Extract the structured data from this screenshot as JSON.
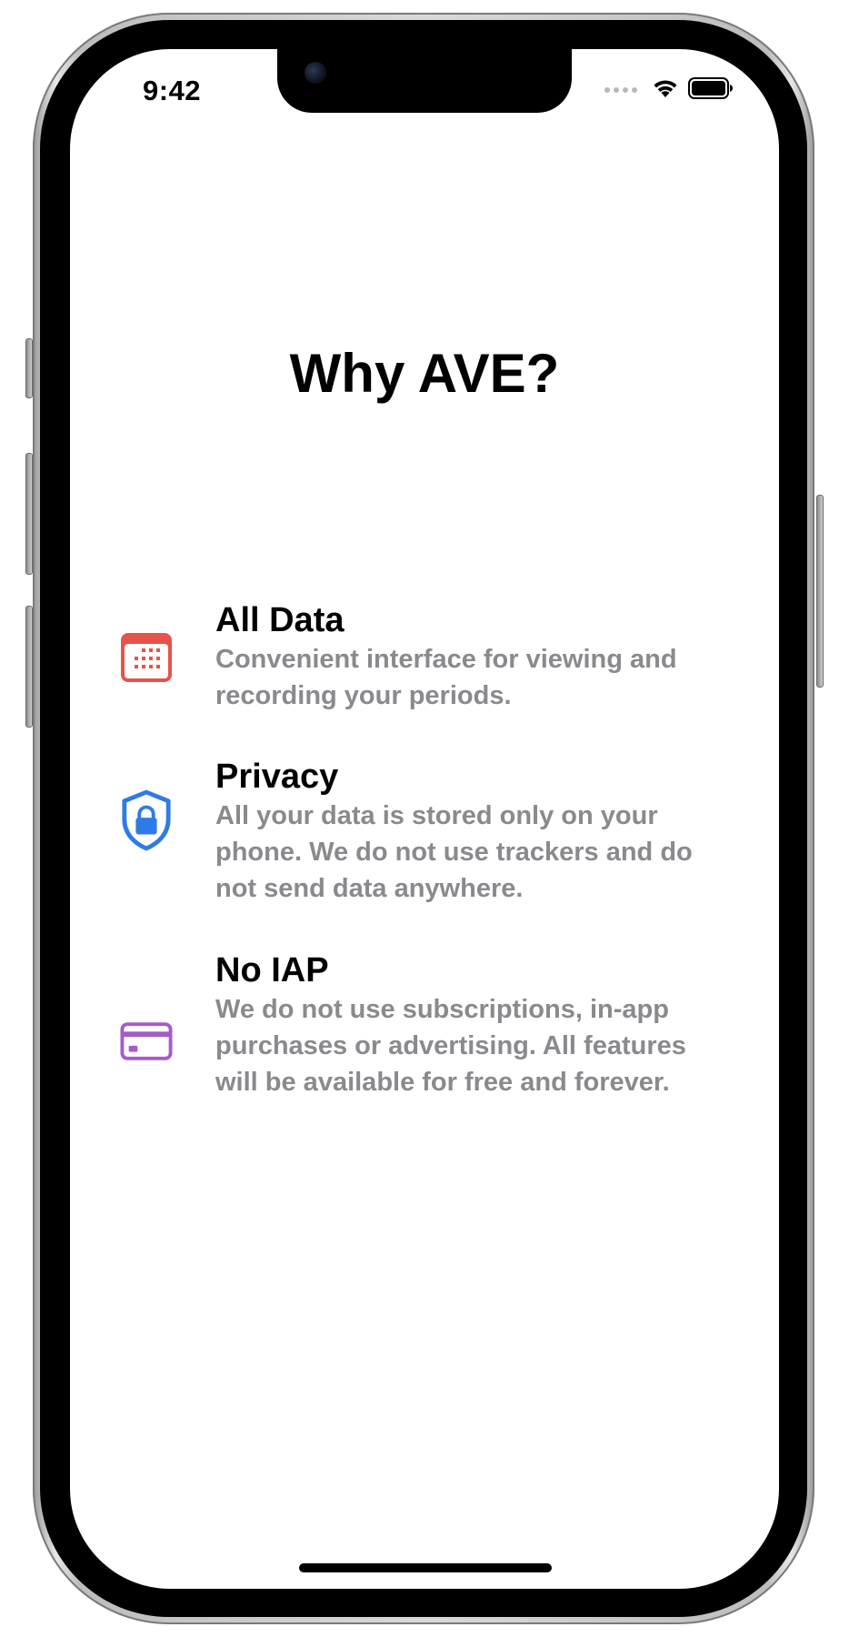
{
  "status_bar": {
    "time": "9:42",
    "wifi_icon": "wifi-icon",
    "battery_icon": "battery-icon"
  },
  "screen": {
    "title": "Why AVE?"
  },
  "features": [
    {
      "icon": "calendar-icon",
      "icon_color": "#E5534B",
      "title": "All Data",
      "description": "Convenient interface for viewing and recording your periods."
    },
    {
      "icon": "shield-lock-icon",
      "icon_color": "#2F7BE5",
      "title": "Privacy",
      "description": "All your data is stored only on your phone. We do not use trackers and do not send data anywhere."
    },
    {
      "icon": "credit-card-icon",
      "icon_color": "#A55BCB",
      "title": "No IAP",
      "description": "We do not use subscriptions, in-app purchases or advertising. All features will be available for free and forever."
    }
  ]
}
